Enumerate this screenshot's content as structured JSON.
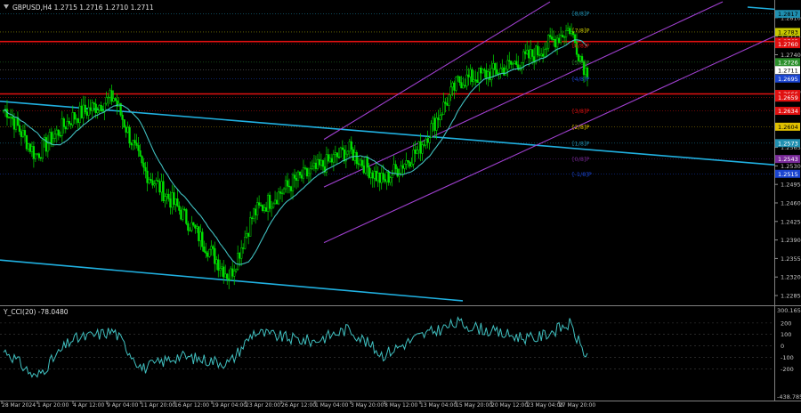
{
  "header": {
    "title": "GBPUSD,H4  1.2715 1.2716 1.2710 1.2711"
  },
  "cci": {
    "label": "Y_CCI(20) -78.0480",
    "top_value": "300.1654",
    "bottom_value": "-438.785"
  },
  "price_axis": {
    "tick_labels": [
      "1.2810",
      "1.2775",
      "1.2740",
      "1.2670",
      "1.2635",
      "1.2565",
      "1.2530",
      "1.2495",
      "1.2460",
      "1.2425",
      "1.2390",
      "1.2355",
      "1.2320",
      "1.2285"
    ],
    "current_price": "1.2711",
    "badges": [
      {
        "text": "1.2817",
        "value": 1.2817,
        "color": "#1f8fb0",
        "fg": "#000000"
      },
      {
        "text": "1.2783",
        "value": 1.2783,
        "color": "#c8c800",
        "fg": "#000000"
      },
      {
        "text": "1.2765",
        "value": 1.2765,
        "color": "#e01010",
        "fg": "#ffffff"
      },
      {
        "text": "1.2760",
        "value": 1.276,
        "color": "#e01010",
        "fg": "#ffffff"
      },
      {
        "text": "1.2726",
        "value": 1.2726,
        "color": "#2a8f2a",
        "fg": "#ffffff"
      },
      {
        "text": "1.2711",
        "value": 1.2711,
        "color": "#ffffff",
        "fg": "#000000"
      },
      {
        "text": "1.2695",
        "value": 1.2695,
        "color": "#1a44d0",
        "fg": "#ffffff"
      },
      {
        "text": "1.2666",
        "value": 1.2666,
        "color": "#e01010",
        "fg": "#ffffff"
      },
      {
        "text": "1.2659",
        "value": 1.2659,
        "color": "#e01010",
        "fg": "#ffffff"
      },
      {
        "text": "1.2634",
        "value": 1.2634,
        "color": "#e01010",
        "fg": "#ffffff"
      },
      {
        "text": "1.2604",
        "value": 1.2604,
        "color": "#e0c000",
        "fg": "#000000"
      },
      {
        "text": "1.2573",
        "value": 1.2573,
        "color": "#1f8fb0",
        "fg": "#ffffff"
      },
      {
        "text": "1.2543",
        "value": 1.2543,
        "color": "#7a2a9a",
        "fg": "#ffffff"
      },
      {
        "text": "1.2515",
        "value": 1.2515,
        "color": "#1a44d0",
        "fg": "#ffffff"
      }
    ]
  },
  "cci_axis": {
    "tick_labels": [
      "200",
      "100",
      "0",
      "-100",
      "-200"
    ]
  },
  "time_axis": {
    "labels": [
      "28 Mar 2024",
      "1 Apr 20:00",
      "4 Apr 12:00",
      "9 Apr 04:00",
      "11 Apr 20:00",
      "16 Apr 12:00",
      "19 Apr 04:00",
      "23 Apr 20:00",
      "26 Apr 12:00",
      "1 May 04:00",
      "3 May 20:00",
      "8 May 12:00",
      "13 May 04:00",
      "15 May 20:00",
      "20 May 12:00",
      "23 May 04:00",
      "27 May 20:00"
    ]
  },
  "murray_labels": [
    {
      "text": "[8/8]P",
      "value": 1.2818,
      "color": "#1f8fb0"
    },
    {
      "text": "[7/8]P",
      "value": 1.2786,
      "color": "#c8c800"
    },
    {
      "text": "[6/8]P",
      "value": 1.2758,
      "color": "#e01010"
    },
    {
      "text": "[5/8]P",
      "value": 1.2726,
      "color": "#2a8f2a"
    },
    {
      "text": "[4/8]P",
      "value": 1.2695,
      "color": "#1a44d0"
    },
    {
      "text": "[3/8]P",
      "value": 1.2634,
      "color": "#e01010"
    },
    {
      "text": "[2/8]P",
      "value": 1.2604,
      "color": "#e0c000"
    },
    {
      "text": "[1/8]P",
      "value": 1.2573,
      "color": "#1f8fb0"
    },
    {
      "text": "[0/8]P",
      "value": 1.2543,
      "color": "#7a2a9a"
    },
    {
      "text": "[-1/8]P",
      "value": 1.2515,
      "color": "#1a44d0"
    }
  ],
  "colors": {
    "background": "#000000",
    "grid": "#1a1a1a",
    "bull": "#00e000",
    "bear": "#00e000",
    "ma": "#40c0c0",
    "trendline": "#20b0e0",
    "channel": "#a040d0",
    "red_level": "#e01010",
    "cci_line": "#40c0c0"
  },
  "chart_data": [
    {
      "type": "line",
      "title": "GBPUSD,H4",
      "xlabel": "",
      "ylabel": "",
      "ylim": [
        1.228,
        1.283
      ],
      "x": [
        "28 Mar 2024",
        "1 Apr 20:00",
        "4 Apr 12:00",
        "9 Apr 04:00",
        "11 Apr 20:00",
        "16 Apr 12:00",
        "19 Apr 04:00",
        "23 Apr 20:00",
        "26 Apr 12:00",
        "1 May 04:00",
        "3 May 20:00",
        "8 May 12:00",
        "13 May 04:00",
        "15 May 20:00",
        "20 May 12:00",
        "23 May 04:00",
        "27 May 20:00",
        "28 May"
      ],
      "series": [
        {
          "name": "GBPUSD,H4",
          "values": [
            1.2635,
            1.255,
            1.262,
            1.266,
            1.2525,
            1.245,
            1.232,
            1.244,
            1.25,
            1.252,
            1.256,
            1.25,
            1.256,
            1.269,
            1.271,
            1.274,
            1.279,
            1.2711
          ]
        }
      ]
    },
    {
      "type": "line",
      "title": "Y_CCI(20) -78.0480",
      "ylim": [
        -438.785,
        300.1654
      ],
      "x": [
        "28 Mar 2024",
        "1 Apr 20:00",
        "4 Apr 12:00",
        "9 Apr 04:00",
        "11 Apr 20:00",
        "16 Apr 12:00",
        "19 Apr 04:00",
        "23 Apr 20:00",
        "26 Apr 12:00",
        "1 May 04:00",
        "3 May 20:00",
        "8 May 12:00",
        "13 May 04:00",
        "15 May 20:00",
        "20 May 12:00",
        "23 May 04:00",
        "27 May 20:00",
        "28 May"
      ],
      "series": [
        {
          "name": "Y_CCI(20)",
          "values": [
            -50,
            -280,
            50,
            130,
            -200,
            -90,
            -150,
            120,
            60,
            40,
            150,
            -80,
            80,
            200,
            110,
            60,
            190,
            -78
          ]
        }
      ]
    }
  ]
}
